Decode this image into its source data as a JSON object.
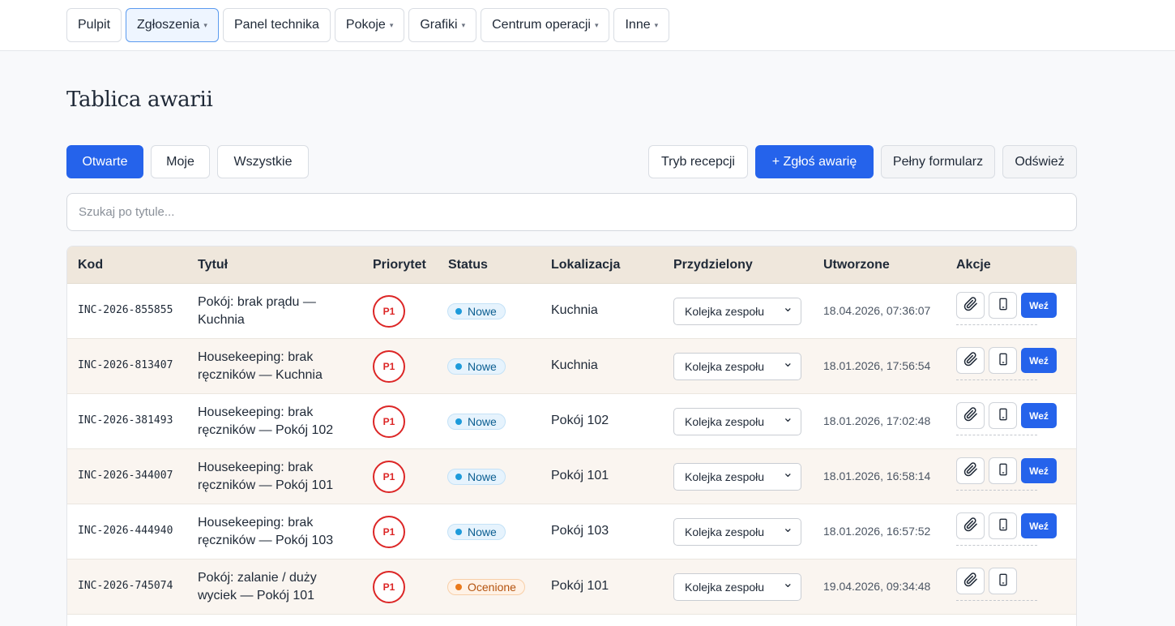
{
  "nav": [
    {
      "label": "Pulpit",
      "dropdown": false,
      "active": false
    },
    {
      "label": "Zgłoszenia",
      "dropdown": true,
      "active": true
    },
    {
      "label": "Panel technika",
      "dropdown": false,
      "active": false
    },
    {
      "label": "Pokoje",
      "dropdown": true,
      "active": false
    },
    {
      "label": "Grafiki",
      "dropdown": true,
      "active": false
    },
    {
      "label": "Centrum operacji",
      "dropdown": true,
      "active": false
    },
    {
      "label": "Inne",
      "dropdown": true,
      "active": false
    }
  ],
  "page_title": "Tablica awarii",
  "filters": {
    "open": "Otwarte",
    "mine": "Moje",
    "all": "Wszystkie"
  },
  "toolbar": {
    "reception": "Tryb recepcji",
    "report": "+ Zgłoś awarię",
    "full_form": "Pełny formularz",
    "refresh": "Odśwież"
  },
  "search": {
    "placeholder": "Szukaj po tytule..."
  },
  "table": {
    "headers": {
      "code": "Kod",
      "title": "Tytuł",
      "priority": "Priorytet",
      "status": "Status",
      "location": "Lokalizacja",
      "assigned": "Przydzielony",
      "created": "Utworzone",
      "actions": "Akcje"
    },
    "take_label": "Weź",
    "rows": [
      {
        "code": "INC-2026-855855",
        "title": "Pokój: brak prądu — Kuchnia",
        "priority": "P1",
        "status": "Nowe",
        "status_kind": "new",
        "location": "Kuchnia",
        "assigned": "Kolejka zespołu",
        "created": "18.04.2026, 07:36:07",
        "can_take": true
      },
      {
        "code": "INC-2026-813407",
        "title": "Housekeeping: brak ręczników — Kuchnia",
        "priority": "P1",
        "status": "Nowe",
        "status_kind": "new",
        "location": "Kuchnia",
        "assigned": "Kolejka zespołu",
        "created": "18.01.2026, 17:56:54",
        "can_take": true
      },
      {
        "code": "INC-2026-381493",
        "title": "Housekeeping: brak ręczników — Pokój 102",
        "priority": "P1",
        "status": "Nowe",
        "status_kind": "new",
        "location": "Pokój 102",
        "assigned": "Kolejka zespołu",
        "created": "18.01.2026, 17:02:48",
        "can_take": true
      },
      {
        "code": "INC-2026-344007",
        "title": "Housekeeping: brak ręczników — Pokój 101",
        "priority": "P1",
        "status": "Nowe",
        "status_kind": "new",
        "location": "Pokój 101",
        "assigned": "Kolejka zespołu",
        "created": "18.01.2026, 16:58:14",
        "can_take": true
      },
      {
        "code": "INC-2026-444940",
        "title": "Housekeeping: brak ręczników — Pokój 103",
        "priority": "P1",
        "status": "Nowe",
        "status_kind": "new",
        "location": "Pokój 103",
        "assigned": "Kolejka zespołu",
        "created": "18.01.2026, 16:57:52",
        "can_take": true
      },
      {
        "code": "INC-2026-745074",
        "title": "Pokój: zalanie / duży wyciek — Pokój 101",
        "priority": "P1",
        "status": "Ocenione",
        "status_kind": "rated",
        "location": "Pokój 101",
        "assigned": "Kolejka zespołu",
        "created": "19.04.2026, 09:34:48",
        "can_take": false
      }
    ]
  },
  "colors": {
    "accent": "#2563eb",
    "priority": "#dc2626",
    "header_bg": "#efe7dc"
  }
}
